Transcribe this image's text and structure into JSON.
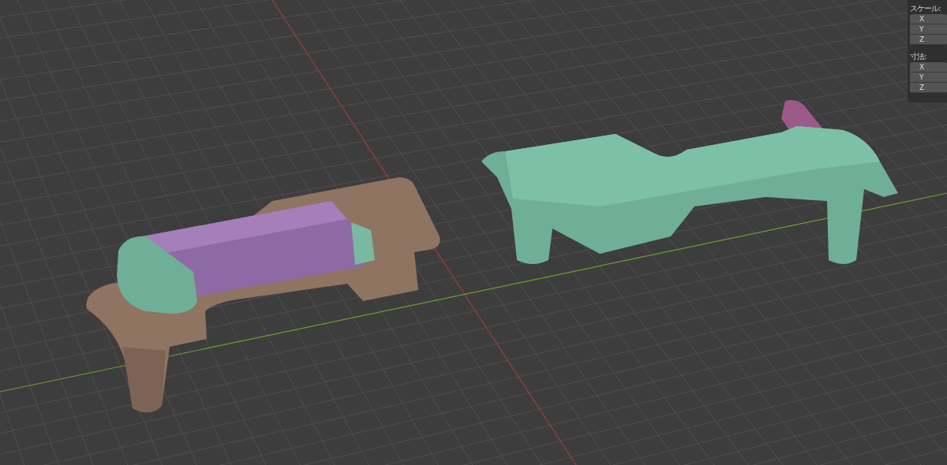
{
  "properties_panel": {
    "sections": [
      {
        "label": "スケール:",
        "fields": [
          "X",
          "Y",
          "Z"
        ]
      },
      {
        "label": "寸法:",
        "fields": [
          "X",
          "Y",
          "Z"
        ]
      }
    ]
  }
}
